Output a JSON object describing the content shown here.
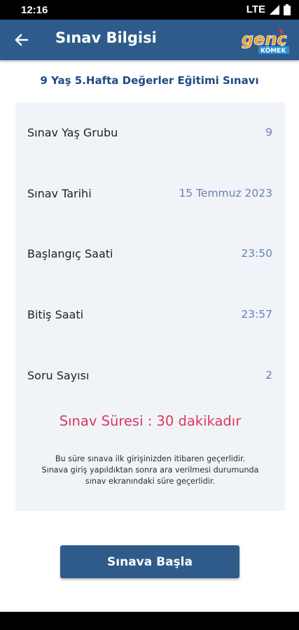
{
  "status_bar": {
    "time": "12:16",
    "network": "LTE"
  },
  "app_bar": {
    "title": "Sınav Bilgisi",
    "back_icon": "arrow-left-icon",
    "logo": "genç kömek logo",
    "color": "#2e5b8a"
  },
  "exam": {
    "title": "9 Yaş 5.Hafta Değerler Eğitimi Sınavı",
    "rows": [
      {
        "label": "Sınav Yaş Grubu",
        "value": "9"
      },
      {
        "label": "Sınav Tarihi",
        "value": "15 Temmuz 2023"
      },
      {
        "label": "Başlangıç Saati",
        "value": "23:50"
      },
      {
        "label": "Bitiş Saati",
        "value": "23:57"
      },
      {
        "label": "Soru Sayısı",
        "value": "2"
      }
    ],
    "duration": "Sınav Süresi : 30 dakikadır",
    "note_lines": [
      "Bu süre sınava ilk girişinizden itibaren geçerlidir.",
      "Sınava giriş yapıldıktan sonra ara verilmesi durumunda",
      "sınav ekranındaki süre geçerlidir."
    ]
  },
  "actions": {
    "start_label": "Sınava Başla"
  },
  "colors": {
    "accent": "#2e5b8a",
    "title": "#1f4a86",
    "value": "#6a80b1",
    "duration": "#e0345c",
    "card": "#f0f4f9"
  }
}
